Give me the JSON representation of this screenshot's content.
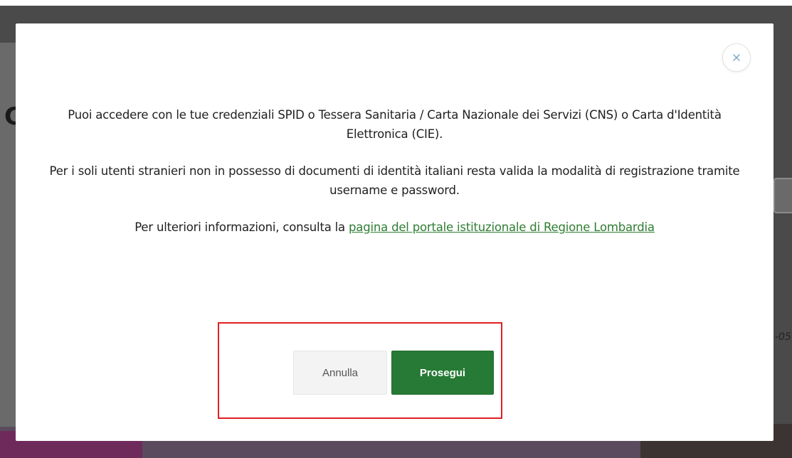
{
  "background_page": {
    "fragment_letter": "C",
    "fragment_text_right": "-05"
  },
  "dialog": {
    "close_icon": "close-icon",
    "paragraph_1": "Puoi accedere con le tue credenziali SPID o Tessera Sanitaria / Carta Nazionale dei Servizi (CNS) o Carta d'Identità Elettronica (CIE).",
    "paragraph_2": "Per i soli utenti stranieri non in possesso di documenti di identità italiani resta valida la modalità di registrazione tramite username e password.",
    "paragraph_3_prefix": "Per ulteriori informazioni, consulta la",
    "info_link_label": "pagina del portale istituzionale di Regione Lombardia",
    "buttons": {
      "cancel_label": "Annulla",
      "continue_label": "Prosegui"
    }
  },
  "colors": {
    "accent_green": "#267a35",
    "link_green": "#2e7d32",
    "highlight_red": "#e01f1f"
  }
}
